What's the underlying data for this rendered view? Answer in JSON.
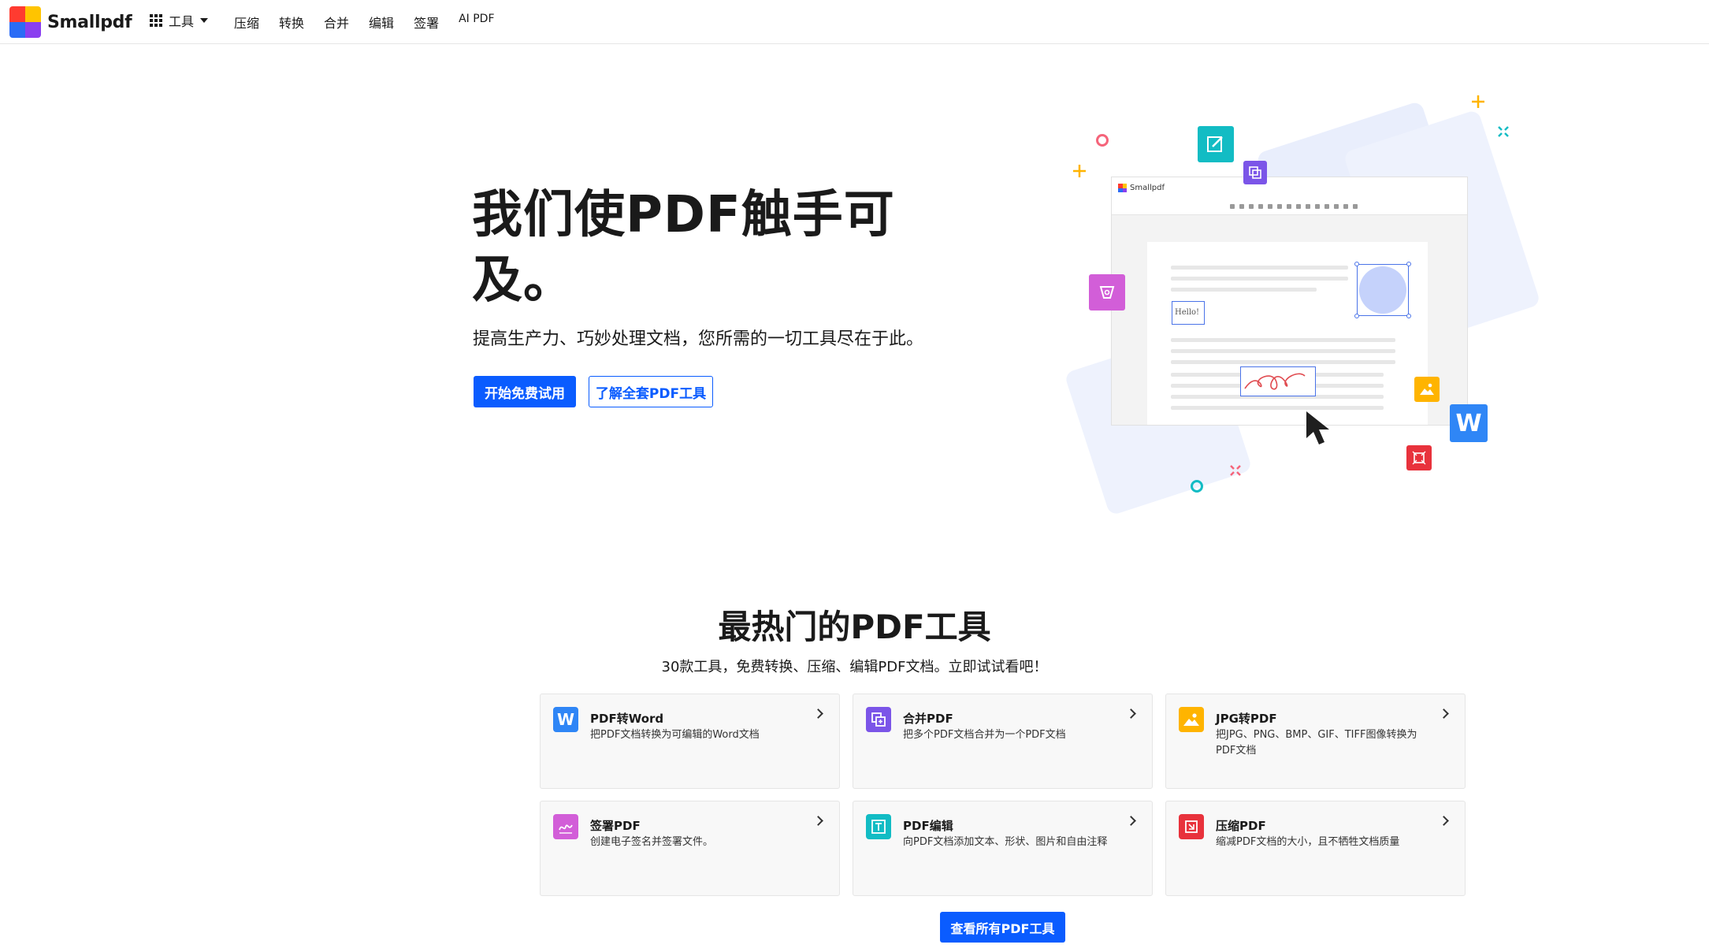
{
  "nav": {
    "logo_text": "Smallpdf",
    "tools_label": "工具",
    "links": [
      "压缩",
      "转换",
      "合并",
      "编辑",
      "签署",
      "AI PDF"
    ]
  },
  "hero": {
    "title": "我们使PDF触手可及。",
    "subtitle": "提高生产力、巧妙处理文档，您所需的一切工具尽在于此。",
    "primary_button": "开始免费试用",
    "secondary_button": "了解全套PDF工具",
    "illustration": {
      "app_name": "Smallpdf",
      "hello_text": "Hello!"
    }
  },
  "tools_section": {
    "title": "最热门的PDF工具",
    "subtitle": "30款工具，免费转换、压缩、编辑PDF文档。立即试试看吧！",
    "cards": [
      {
        "title": "PDF转Word",
        "desc": "把PDF文档转换为可编辑的Word文档",
        "icon": "word-icon",
        "color": "#2f86f6"
      },
      {
        "title": "合并PDF",
        "desc": "把多个PDF文档合并为一个PDF文档",
        "icon": "merge-icon",
        "color": "#7b55e8"
      },
      {
        "title": "JPG转PDF",
        "desc": "把JPG、PNG、BMP、GIF、TIFF图像转换为PDF文档",
        "icon": "image-icon",
        "color": "#ffb400"
      },
      {
        "title": "签署PDF",
        "desc": "创建电子签名并签署文件。",
        "icon": "signature-icon",
        "color": "#d25ed8"
      },
      {
        "title": "PDF编辑",
        "desc": "向PDF文档添加文本、形状、图片和自由注释",
        "icon": "edit-icon",
        "color": "#12bcc4"
      },
      {
        "title": "压缩PDF",
        "desc": "缩减PDF文档的大小，且不牺牲文档质量",
        "icon": "compress-icon",
        "color": "#e8323c"
      }
    ],
    "all_tools_button": "查看所有PDF工具"
  },
  "colors": {
    "brand_blue": "#0a5cff"
  }
}
